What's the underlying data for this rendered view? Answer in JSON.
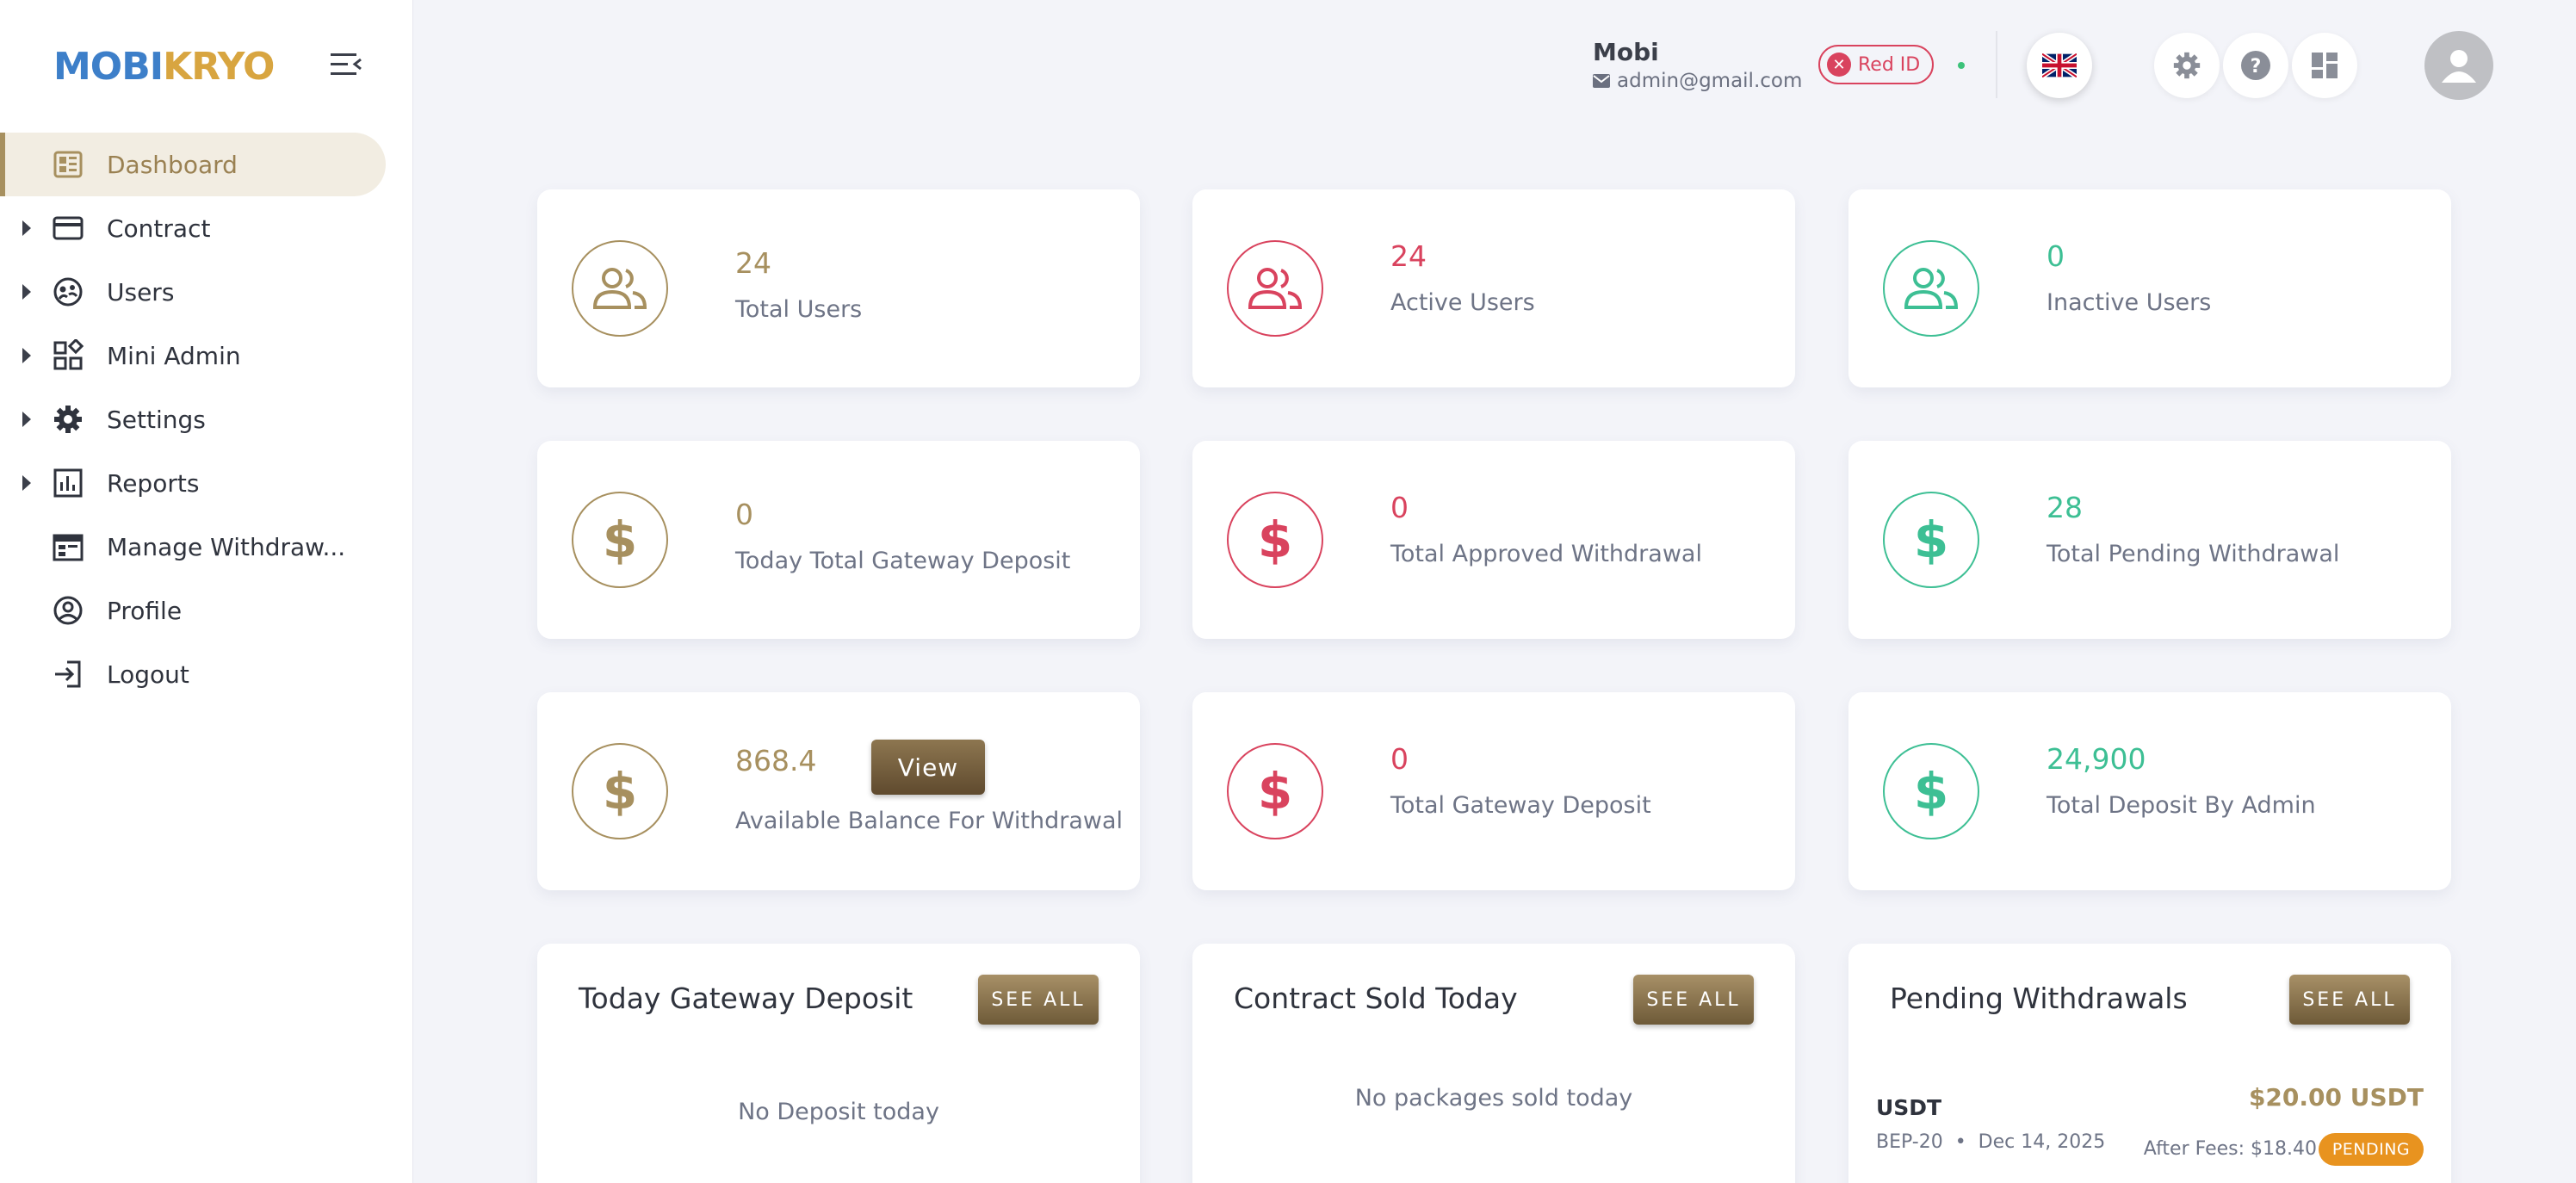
{
  "brand": {
    "logo_part1": "MOBI",
    "logo_part2": "KRYO"
  },
  "sidebar": {
    "items": [
      {
        "label": "Dashboard",
        "icon": "dashboard-icon",
        "active": true,
        "expandable": false
      },
      {
        "label": "Contract",
        "icon": "card-icon",
        "active": false,
        "expandable": true
      },
      {
        "label": "Users",
        "icon": "users-icon",
        "active": false,
        "expandable": true
      },
      {
        "label": "Mini Admin",
        "icon": "grid-icon",
        "active": false,
        "expandable": true
      },
      {
        "label": "Settings",
        "icon": "gear-icon",
        "active": false,
        "expandable": true
      },
      {
        "label": "Reports",
        "icon": "chart-icon",
        "active": false,
        "expandable": true
      },
      {
        "label": "Manage Withdraw...",
        "icon": "calendar-icon",
        "active": false,
        "expandable": false
      },
      {
        "label": "Profile",
        "icon": "profile-icon",
        "active": false,
        "expandable": false
      },
      {
        "label": "Logout",
        "icon": "logout-icon",
        "active": false,
        "expandable": false
      }
    ]
  },
  "header": {
    "user_name": "Mobi",
    "user_email": "admin@gmail.com",
    "red_id_label": "Red ID",
    "language_flag": "uk-flag-icon"
  },
  "colors": {
    "gold": "#a7905f",
    "pink": "#d9435e",
    "teal": "#3dbf94",
    "accent_bg": "#f2ede2"
  },
  "stats": {
    "total_users": {
      "value": "24",
      "label": "Total Users"
    },
    "active_users": {
      "value": "24",
      "label": "Active Users"
    },
    "inactive_users": {
      "value": "0",
      "label": "Inactive Users"
    },
    "today_gateway_deposit": {
      "value": "0",
      "label": "Today Total Gateway Deposit"
    },
    "approved_withdrawal": {
      "value": "0",
      "label": "Total Approved Withdrawal"
    },
    "pending_withdrawal": {
      "value": "28",
      "label": "Total Pending Withdrawal"
    },
    "available_balance": {
      "value": "868.4",
      "label": "Available Balance For Withdrawal",
      "button": "View"
    },
    "gateway_deposit": {
      "value": "0",
      "label": "Total Gateway Deposit"
    },
    "deposit_by_admin": {
      "value": "24,900",
      "label": "Total Deposit By Admin"
    }
  },
  "panels": {
    "today_deposit": {
      "title": "Today Gateway Deposit",
      "button": "SEE ALL",
      "empty": "No Deposit today"
    },
    "contract_sold": {
      "title": "Contract Sold Today",
      "button": "SEE ALL",
      "empty": "No packages sold today"
    },
    "pending_withdrawals": {
      "title": "Pending Withdrawals",
      "button": "SEE ALL",
      "items": [
        {
          "currency": "USDT",
          "network": "BEP-20",
          "date": "Dec 14, 2025",
          "amount": "$20.00 USDT",
          "after_fees": "After Fees: $18.40",
          "status": "PENDING"
        }
      ]
    }
  }
}
